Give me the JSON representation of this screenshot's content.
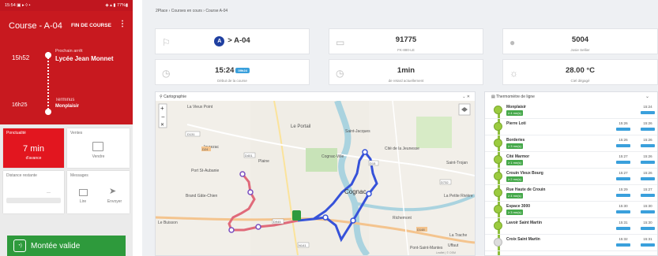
{
  "phone": {
    "status_left": "15:54 ▣ ▸ ◊ •",
    "status_right": "◈ ▴ ▮ 77%▮",
    "title": "Course - A-04",
    "fin_label": "FIN DE COURSE",
    "menu_icon": "⋮",
    "next_time": "15h52",
    "next_label": "Prochain arrêt",
    "next_stop": "Lycée Jean Monnet",
    "term_time": "16h25",
    "term_label": "Terminus",
    "term_stop": "Monplaisir",
    "ponctualite_label": "Ponctualité",
    "ponctualite_value": "7 min",
    "ponctualite_sub": "d'avance",
    "ventes_label": "Ventes",
    "vendre_label": "Vendre",
    "distance_label": "Distance restante",
    "distance_value": "—",
    "messages_label": "Messages",
    "lire_label": "Lire",
    "envoyer_label": "Envoyer",
    "montee_label": "Montée valide",
    "montee_icon": "◔)"
  },
  "web": {
    "breadcrumb": "2Place  ›  Courses en cours  ›  Course A-04",
    "line_badge": "A",
    "line_value": "> A-04",
    "vehicle_value": "91775",
    "vehicle_sub": "FK-880-LE",
    "driver_value": "5004",
    "driver_sub": "Josie Sellier",
    "time_value": "15:24",
    "time_pill": "09h24",
    "time_sub": "Début de la course",
    "delay_value": "1min",
    "delay_sub": "de retard actuellement",
    "temp_value": "28.00 °C",
    "temp_sub": "Ciel dégagé",
    "map_title": "Cartographie",
    "map_controls": "⌄ ✕",
    "therm_title": "Thermomètre de ligne",
    "therm_chev": "⌄"
  },
  "map": {
    "labels": [
      "La Vieux Point",
      "Le Portail",
      "Javrezac",
      "Port St-Aubanie",
      "Brand Gâte-Chien",
      "Le Buisson",
      "Cognac",
      "Saint-Trojan",
      "La Petite Rivière",
      "La Trache",
      "Uffaut",
      "Pont-Saint-Mantes",
      "Cognac-Ville",
      "Plaine",
      "Cité de la Jeunesse",
      "Saint-Jacques",
      "Richemont"
    ],
    "badges": [
      "D131",
      "D24",
      "D401",
      "D945",
      "N141",
      "D15",
      "D148",
      "D732"
    ],
    "attribution": "Leaflet | © OSM"
  },
  "stops": [
    {
      "name": "Monplaisir",
      "badge": "≥ 4 mn(s)",
      "t1": "",
      "t2": "15:24"
    },
    {
      "name": "Pierre Loti",
      "badge": "",
      "t1": "15:26",
      "t2": "15:26"
    },
    {
      "name": "Borderies",
      "badge": "≥ 3 mn(s)",
      "t1": "15:26",
      "t2": "15:26"
    },
    {
      "name": "Cité Marmor",
      "badge": "≥ 1 mn(s)",
      "t1": "15:27",
      "t2": "15:26"
    },
    {
      "name": "Crouin Vieux Bourg",
      "badge": "≥ 2 mn(s)",
      "t1": "15:27",
      "t2": "15:26"
    },
    {
      "name": "Rue Haute de Crouin",
      "badge": "≥ 4 mn(s)",
      "t1": "15:29",
      "t2": "15:27"
    },
    {
      "name": "Espace 3000",
      "badge": "≥ 3 mn(s)",
      "t1": "15:30",
      "t2": "15:30"
    },
    {
      "name": "Lavoir Saint Martin",
      "badge": "",
      "t1": "15:31",
      "t2": "15:30"
    },
    {
      "name": "Croix Saint Martin",
      "badge": "",
      "t1": "15:32",
      "t2": "15:31"
    }
  ],
  "colors": {
    "red": "#c8191f",
    "green": "#2e9a3c",
    "blue": "#1f3fa0",
    "accent": "#3aa0dc"
  }
}
